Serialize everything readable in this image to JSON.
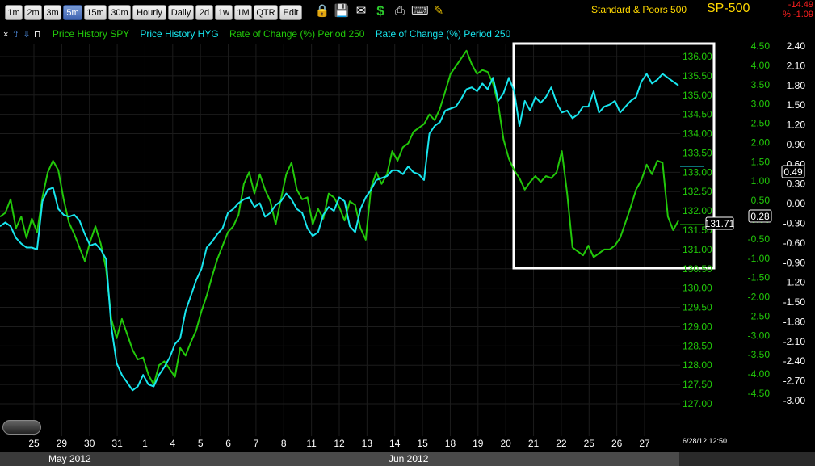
{
  "toolbar": {
    "buttons": [
      "1m",
      "2m",
      "3m",
      "5m",
      "15m",
      "30m",
      "Hourly",
      "Daily",
      "2d",
      "1w",
      "1M",
      "QTR",
      "Edit"
    ],
    "active": "5m",
    "icons": [
      "lock-icon",
      "save-icon",
      "email-icon",
      "dollar-icon",
      "print-icon",
      "keyboard-icon",
      "pencil-icon"
    ]
  },
  "symbol": {
    "name": "Standard & Poors 500",
    "ticker": "SP-500",
    "change_pts": "-14.49",
    "change_pct": "% -1.09"
  },
  "legend": {
    "controls": [
      "×",
      "⇧",
      "⇩",
      "⊓"
    ],
    "items": [
      {
        "label": "Price History SPY",
        "color": "#22c80a"
      },
      {
        "label": "Price History HYG",
        "color": "#18e6ee"
      },
      {
        "label": "Rate of Change (%) Period 250",
        "color": "#22c80a"
      },
      {
        "label": "Rate of Change (%) Period 250",
        "color": "#18e6ee"
      }
    ]
  },
  "timestamp": "6/28/12 12:50",
  "months": [
    "May 2012",
    "Jun 2012"
  ],
  "chart_data": {
    "type": "line",
    "x_labels": [
      "25",
      "29",
      "30",
      "31",
      "1",
      "4",
      "5",
      "6",
      "7",
      "8",
      "11",
      "12",
      "13",
      "14",
      "15",
      "18",
      "19",
      "20",
      "21",
      "22",
      "25",
      "26",
      "27"
    ],
    "price_axis": {
      "ticks": [
        "136.00",
        "135.50",
        "135.00",
        "134.50",
        "134.00",
        "133.50",
        "133.00",
        "132.50",
        "132.00",
        "131.50",
        "131.00",
        "130.50",
        "130.00",
        "129.50",
        "129.00",
        "128.50",
        "128.00",
        "127.50",
        "127.00"
      ],
      "range": [
        126.9,
        136.3
      ],
      "color": "#22c80a"
    },
    "roc_axis_spy": {
      "ticks": [
        "4.50",
        "4.00",
        "3.50",
        "3.00",
        "2.50",
        "2.00",
        "1.50",
        "1.00",
        "0.50",
        "0.00",
        "-0.50",
        "-1.00",
        "-1.50",
        "-2.00",
        "-2.50",
        "-3.00",
        "-3.50",
        "-4.00",
        "-4.50"
      ],
      "range": [
        -4.7,
        4.8
      ],
      "color": "#22c80a"
    },
    "roc_axis_hyg": {
      "ticks": [
        "2.40",
        "2.10",
        "1.80",
        "1.50",
        "1.20",
        "0.90",
        "0.60",
        "0.30",
        "0.00",
        "-0.30",
        "-0.60",
        "-0.90",
        "-1.20",
        "-1.50",
        "-1.80",
        "-2.10",
        "-2.40",
        "-2.70",
        "-3.00"
      ],
      "range": [
        -3.15,
        2.55
      ],
      "color": "#ffffff"
    },
    "price_label": "131.71",
    "roc_spy_label": "0.28",
    "roc_hyg_label": "0.49",
    "series": [
      {
        "name": "Price History SPY",
        "color": "#22c80a",
        "values": [
          131.85,
          131.95,
          132.3,
          131.55,
          131.85,
          131.3,
          131.8,
          131.45,
          132.35,
          133.0,
          133.3,
          133.05,
          132.3,
          131.7,
          131.4,
          131.05,
          130.7,
          131.2,
          131.6,
          131.15,
          130.5,
          129.2,
          128.7,
          129.2,
          128.8,
          128.4,
          128.15,
          128.2,
          127.75,
          127.5,
          128.0,
          128.1,
          127.9,
          127.7,
          128.45,
          128.25,
          128.6,
          128.9,
          129.4,
          129.8,
          130.3,
          130.75,
          131.1,
          131.45,
          131.6,
          131.9,
          132.7,
          133.0,
          132.45,
          132.95,
          132.55,
          132.25,
          131.65,
          132.3,
          132.95,
          133.25,
          132.55,
          132.3,
          132.35,
          131.65,
          132.05,
          131.8,
          132.45,
          132.35,
          132.1,
          131.75,
          132.25,
          132.15,
          131.55,
          131.25,
          132.6,
          133.0,
          132.7,
          132.95,
          133.55,
          133.3,
          133.65,
          133.75,
          134.05,
          134.15,
          134.25,
          134.5,
          134.35,
          134.65,
          135.1,
          135.55,
          135.75,
          135.95,
          136.15,
          135.8,
          135.55,
          135.65,
          135.6,
          135.3,
          134.75,
          133.85,
          133.35,
          133.05,
          132.85,
          132.55,
          132.75,
          132.9,
          132.75,
          132.9,
          132.85,
          133.0,
          133.55,
          132.45,
          131.05,
          130.95,
          130.85,
          131.1,
          130.8,
          130.9,
          131.0,
          131.0,
          131.1,
          131.3,
          131.7,
          132.1,
          132.55,
          132.8,
          133.2,
          132.95,
          133.3,
          133.25,
          131.85,
          131.5,
          131.75
        ]
      },
      {
        "name": "Price History HYG",
        "color": "#18e6ee",
        "values": [
          131.6,
          131.7,
          131.6,
          131.3,
          131.15,
          131.05,
          131.05,
          131.0,
          132.25,
          132.55,
          132.6,
          132.05,
          131.9,
          131.85,
          131.9,
          131.75,
          131.4,
          131.1,
          131.15,
          131.0,
          130.75,
          129.0,
          128.05,
          127.75,
          127.55,
          127.35,
          127.45,
          127.75,
          127.5,
          127.45,
          127.75,
          127.95,
          128.2,
          128.55,
          128.7,
          129.4,
          129.8,
          130.2,
          130.5,
          131.05,
          131.2,
          131.4,
          131.55,
          131.95,
          132.05,
          132.2,
          132.3,
          132.35,
          132.1,
          132.2,
          131.85,
          131.95,
          132.15,
          132.25,
          132.45,
          132.3,
          132.05,
          131.95,
          131.55,
          131.35,
          131.45,
          131.9,
          132.1,
          132.0,
          132.35,
          132.25,
          131.6,
          131.45,
          132.05,
          132.35,
          132.55,
          132.8,
          132.85,
          132.9,
          133.05,
          133.05,
          132.95,
          133.15,
          133.0,
          132.95,
          132.8,
          134.0,
          134.2,
          134.3,
          134.6,
          134.65,
          134.7,
          134.9,
          135.15,
          135.2,
          135.1,
          135.3,
          135.15,
          135.45,
          134.85,
          135.05,
          135.45,
          135.1,
          134.2,
          134.85,
          134.6,
          134.95,
          134.8,
          134.95,
          135.2,
          134.8,
          134.55,
          134.6,
          134.4,
          134.5,
          134.7,
          134.7,
          135.1,
          134.55,
          134.7,
          134.75,
          134.85,
          134.55,
          134.7,
          134.85,
          134.95,
          135.35,
          135.55,
          135.3,
          135.4,
          135.55,
          135.45,
          135.35,
          135.25
        ]
      }
    ]
  }
}
